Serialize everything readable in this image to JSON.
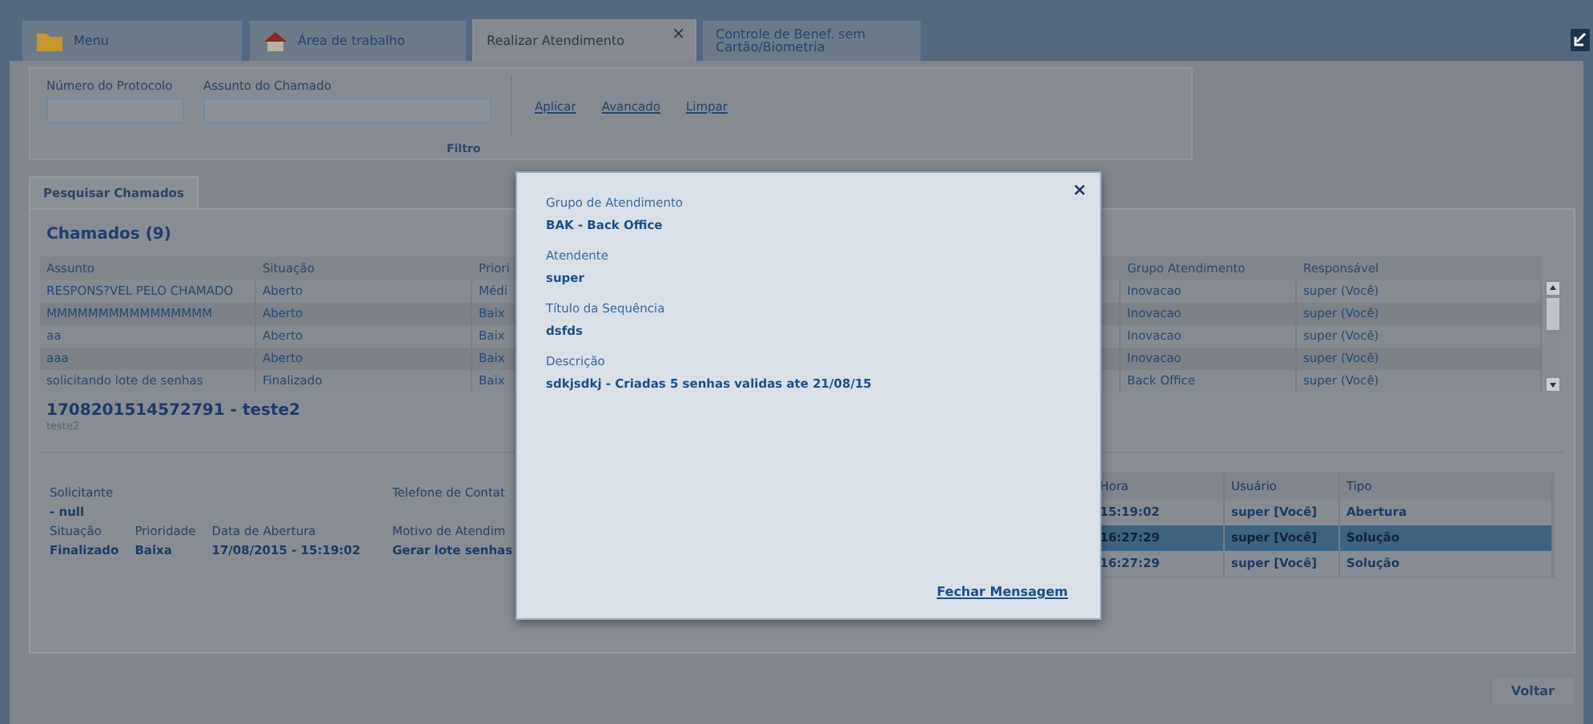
{
  "tabs": [
    {
      "label": "Menu",
      "kind": "folder",
      "selected": false
    },
    {
      "label": "Área de trabalho",
      "kind": "house",
      "selected": false
    },
    {
      "label": "Realizar Atendimento",
      "kind": "plain",
      "selected": true,
      "close": "×"
    },
    {
      "label": "Controle de Benef. sem Cartão/Biometria",
      "kind": "plain",
      "selected": false
    }
  ],
  "filter": {
    "fields": [
      {
        "label": "Número do Protocolo"
      },
      {
        "label": "Assunto do Chamado"
      }
    ],
    "links": [
      "Aplicar",
      "Avancado",
      "Limpar"
    ],
    "caption": "Filtro"
  },
  "subtabs": [
    {
      "label": "Pesquisar Chamados",
      "selected": true
    }
  ],
  "calls": {
    "title": "Chamados (9)",
    "columns": [
      "Assunto",
      "Situação",
      "Priori",
      "Grupo Atendimento",
      "Responsável"
    ],
    "rows": [
      [
        "RESPONS?VEL PELO CHAMADO",
        "Aberto",
        "Médi",
        "Inovacao",
        "super (Você)"
      ],
      [
        "MMMMMMMMMMMMMMMM",
        "Aberto",
        "Baix",
        "Inovacao",
        "super (Você)"
      ],
      [
        "aa",
        "Aberto",
        "Baix",
        "Inovacao",
        "super (Você)"
      ],
      [
        "aaa",
        "Aberto",
        "Baix",
        "Inovacao",
        "super (Você)"
      ],
      [
        "solicitando lote de senhas",
        "Finalizado",
        "Baix",
        "Back Office",
        "super (Você)"
      ]
    ]
  },
  "detail": {
    "title": "1708201514572791 - teste2",
    "subtitle": "teste2",
    "requester": {
      "label": "Solicitante",
      "value": "- null"
    },
    "status": [
      {
        "label": "Situação",
        "value": "Finalizado"
      },
      {
        "label": "Prioridade",
        "value": "Baixa"
      },
      {
        "label": "Data de Abertura",
        "value": "17/08/2015 - 15:19:02"
      }
    ],
    "phone": {
      "label": "Telefone de Contat"
    },
    "reason": {
      "label": "Motivo de Atendim",
      "value": "Gerar lote senhas"
    }
  },
  "history": {
    "columns": [
      "Hora",
      "Usuário",
      "Tipo"
    ],
    "rows": [
      {
        "cells": [
          "15:19:02",
          "super [Você]",
          "Abertura"
        ],
        "selected": false
      },
      {
        "cells": [
          "16:27:29",
          "super [Você]",
          "Solução"
        ],
        "selected": true
      },
      {
        "cells": [
          "16:27:29",
          "super [Você]",
          "Solução"
        ],
        "selected": false
      }
    ]
  },
  "back_button": "Voltar",
  "modal": {
    "close": "×",
    "fields": [
      {
        "label": "Grupo de Atendimento",
        "value": "BAK - Back Office"
      },
      {
        "label": "Atendente",
        "value": "super"
      },
      {
        "label": "Título da Sequência",
        "value": "dsfds"
      },
      {
        "label": "Descrição",
        "value": "sdkjsdkj - Criadas 5 senhas validas ate 21/08/15"
      }
    ],
    "link": "Fechar Mensagem"
  }
}
